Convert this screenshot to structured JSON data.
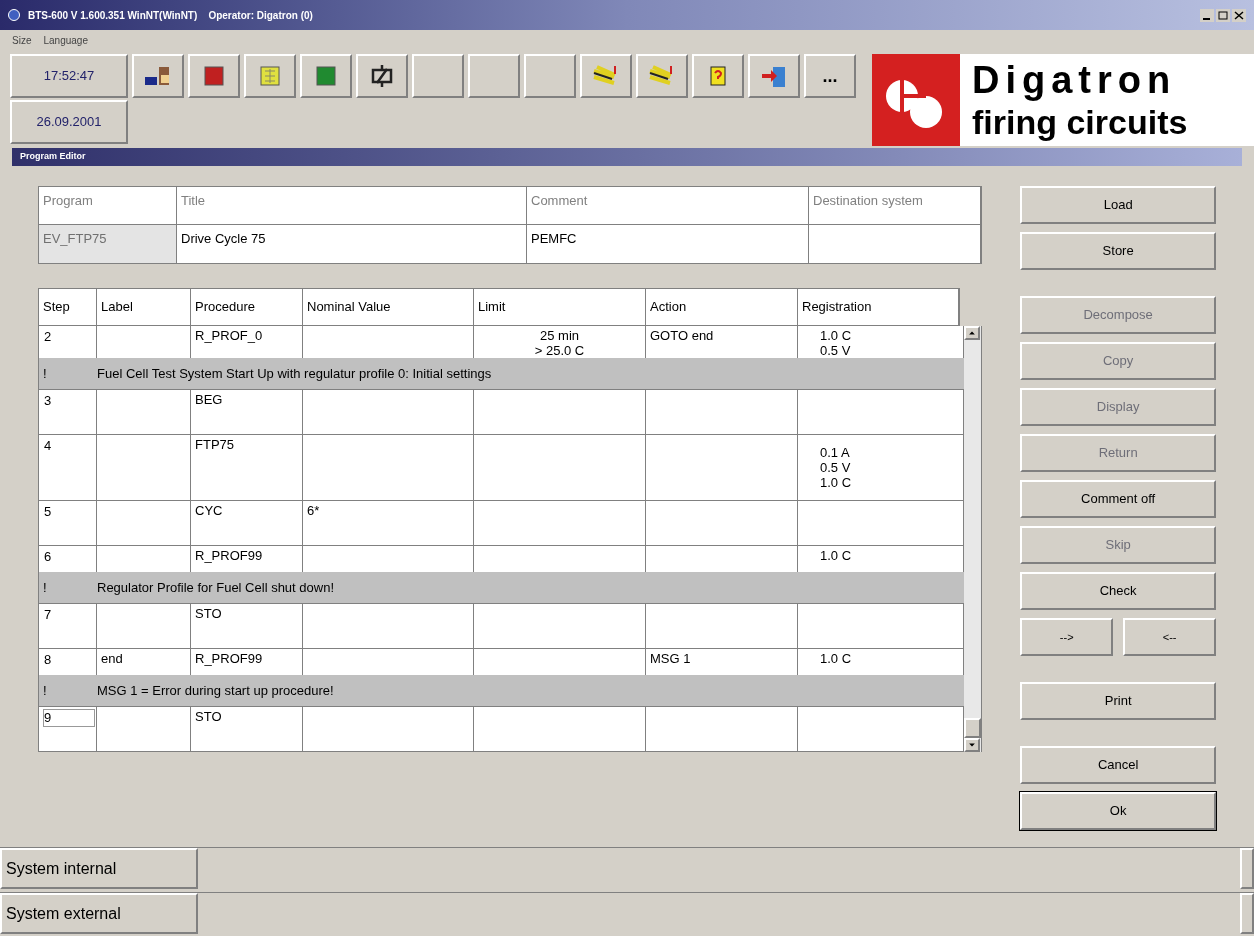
{
  "title_bar": {
    "title": "BTS-600 V 1.600.351 WinNT(WinNT)    Operator: Digatron (0)"
  },
  "menu": [
    "Size",
    "Language"
  ],
  "clock": {
    "time": "17:52:47",
    "date": "26.09.2001"
  },
  "toolbar": [
    {
      "kind": "icon"
    },
    {
      "kind": "icon"
    },
    {
      "kind": "icon"
    },
    {
      "kind": "icon"
    },
    {
      "kind": "icon"
    },
    {
      "kind": "empty"
    },
    {
      "kind": "empty"
    },
    {
      "kind": "empty"
    },
    {
      "kind": "icon"
    },
    {
      "kind": "icon"
    },
    {
      "kind": "icon"
    },
    {
      "kind": "icon"
    },
    {
      "kind": "text",
      "label": "..."
    }
  ],
  "logo": {
    "name": "Digatron",
    "tagline": "firing circuits"
  },
  "editor": {
    "title": "Program Editor"
  },
  "program_fields": [
    {
      "label": "Program",
      "value": "EV_FTP75",
      "disabled": true
    },
    {
      "label": "Title",
      "value": "Drive Cycle 75",
      "disabled": false
    },
    {
      "label": "Comment",
      "value": "PEMFC",
      "disabled": false
    },
    {
      "label": "Destination system",
      "disabled": false
    }
  ],
  "steps_table": {
    "columns": [
      "Step",
      "Label",
      "Procedure",
      "Nominal Value",
      "Limit",
      "Action",
      "Registration"
    ],
    "rows": [
      {
        "kind": "step",
        "selected": false,
        "step": "2",
        "procedure": "R_PROF_0",
        "limit": [
          "25 min",
          "> 25.0 C"
        ],
        "action": "GOTO end",
        "registration": [
          "1.0 C",
          "0.5 V"
        ]
      },
      {
        "kind": "comment",
        "marker": "!",
        "text": "Fuel Cell Test System Start Up with regulatur profile 0: Initial settings"
      },
      {
        "kind": "step",
        "selected": false,
        "step": "3",
        "procedure": "BEG"
      },
      {
        "kind": "step",
        "selected": false,
        "step": "4",
        "procedure": "FTP75",
        "registration": [
          "0.1 A",
          "0.5 V",
          "1.0 C"
        ]
      },
      {
        "kind": "step",
        "selected": false,
        "step": "5",
        "procedure": "CYC",
        "nominal": "6*"
      },
      {
        "kind": "step",
        "selected": false,
        "step": "6",
        "procedure": "R_PROF99",
        "registration": [
          "1.0 C"
        ]
      },
      {
        "kind": "comment",
        "marker": "!",
        "text": "Regulator Profile for Fuel Cell shut down!"
      },
      {
        "kind": "step",
        "selected": false,
        "step": "7",
        "procedure": "STO"
      },
      {
        "kind": "step",
        "selected": false,
        "step": "8",
        "label": "end",
        "procedure": "R_PROF99",
        "action": "MSG 1",
        "registration": [
          "1.0 C"
        ]
      },
      {
        "kind": "comment",
        "marker": "!",
        "text": "MSG 1 = Error during start up procedure!"
      },
      {
        "kind": "step",
        "selected": true,
        "step": "9",
        "procedure": "STO"
      }
    ]
  },
  "buttons": [
    {
      "kind": "button",
      "label": "Load",
      "disabled": false,
      "default": false
    },
    {
      "kind": "button",
      "label": "Store",
      "disabled": false,
      "default": false
    },
    {
      "kind": "gap"
    },
    {
      "kind": "button",
      "label": "Decompose",
      "disabled": true,
      "default": false
    },
    {
      "kind": "button",
      "label": "Copy",
      "disabled": true,
      "default": false
    },
    {
      "kind": "button",
      "label": "Display",
      "disabled": true,
      "default": false
    },
    {
      "kind": "button",
      "label": "Return",
      "disabled": true,
      "default": false
    },
    {
      "kind": "button",
      "label": "Comment off",
      "disabled": false,
      "default": false
    },
    {
      "kind": "button",
      "label": "Skip",
      "disabled": true,
      "default": false
    },
    {
      "kind": "button",
      "label": "Check",
      "disabled": false,
      "default": false
    },
    {
      "kind": "pair",
      "labels": [
        "-->",
        "<--"
      ]
    },
    {
      "kind": "gap"
    },
    {
      "kind": "button",
      "label": "Print",
      "disabled": false,
      "default": false
    },
    {
      "kind": "gap"
    },
    {
      "kind": "button",
      "label": "Cancel",
      "disabled": false,
      "default": false
    },
    {
      "kind": "button",
      "label": "Ok",
      "disabled": false,
      "default": true
    }
  ],
  "status_bars": [
    {
      "label": "System internal"
    },
    {
      "label": "System external"
    }
  ]
}
